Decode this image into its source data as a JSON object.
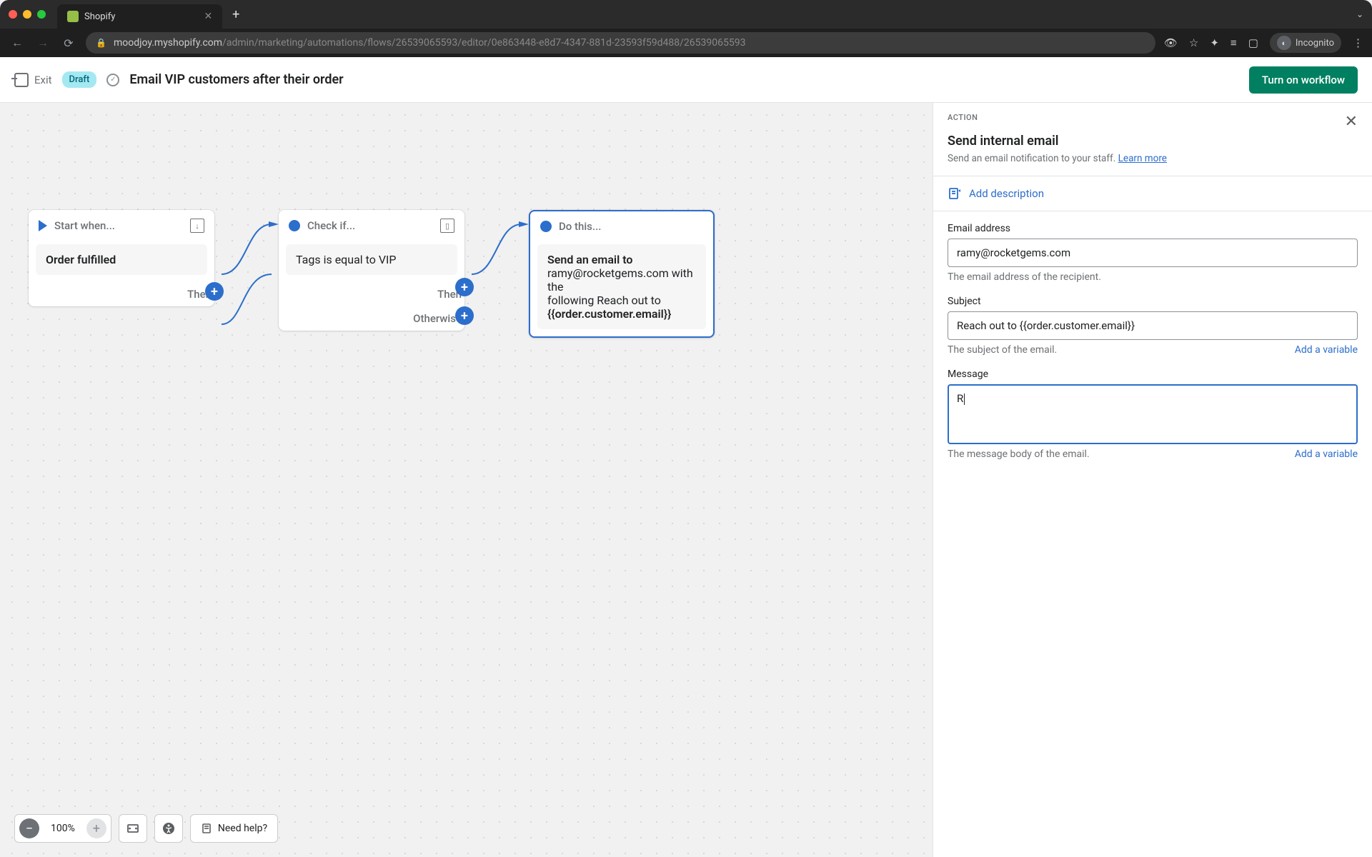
{
  "browser": {
    "tab_title": "Shopify",
    "url_host": "moodjoy.myshopify.com",
    "url_path": "/admin/marketing/automations/flows/26539065593/editor/0e863448-e8d7-4347-881d-23593f59d488/26539065593",
    "incognito_label": "Incognito"
  },
  "appbar": {
    "exit_label": "Exit",
    "draft_badge": "Draft",
    "title": "Email VIP customers after their order",
    "primary_button": "Turn on workflow"
  },
  "flow": {
    "start": {
      "title": "Start when...",
      "body": "Order fulfilled",
      "then_label": "Then"
    },
    "check": {
      "title": "Check if...",
      "body": "Tags is equal to VIP",
      "then_label": "Then",
      "otherwise_label": "Otherwise"
    },
    "do": {
      "title": "Do this...",
      "body_line1": "Send an email to",
      "body_line2": "ramy@rocketgems.com with the",
      "body_line3": "following Reach out to",
      "body_line4": "{{order.customer.email}}"
    }
  },
  "panel": {
    "kicker": "ACTION",
    "title": "Send internal email",
    "description": "Send an email notification to your staff. ",
    "learn_more": "Learn more",
    "add_description": "Add description",
    "email": {
      "label": "Email address",
      "value": "ramy@rocketgems.com",
      "help": "The email address of the recipient."
    },
    "subject": {
      "label": "Subject",
      "value": "Reach out to {{order.customer.email}}",
      "help": "The subject of the email.",
      "add_var": "Add a variable"
    },
    "message": {
      "label": "Message",
      "value": "R",
      "help": "The message body of the email.",
      "add_var": "Add a variable"
    }
  },
  "bottombar": {
    "zoom": "100%",
    "help": "Need help?"
  }
}
